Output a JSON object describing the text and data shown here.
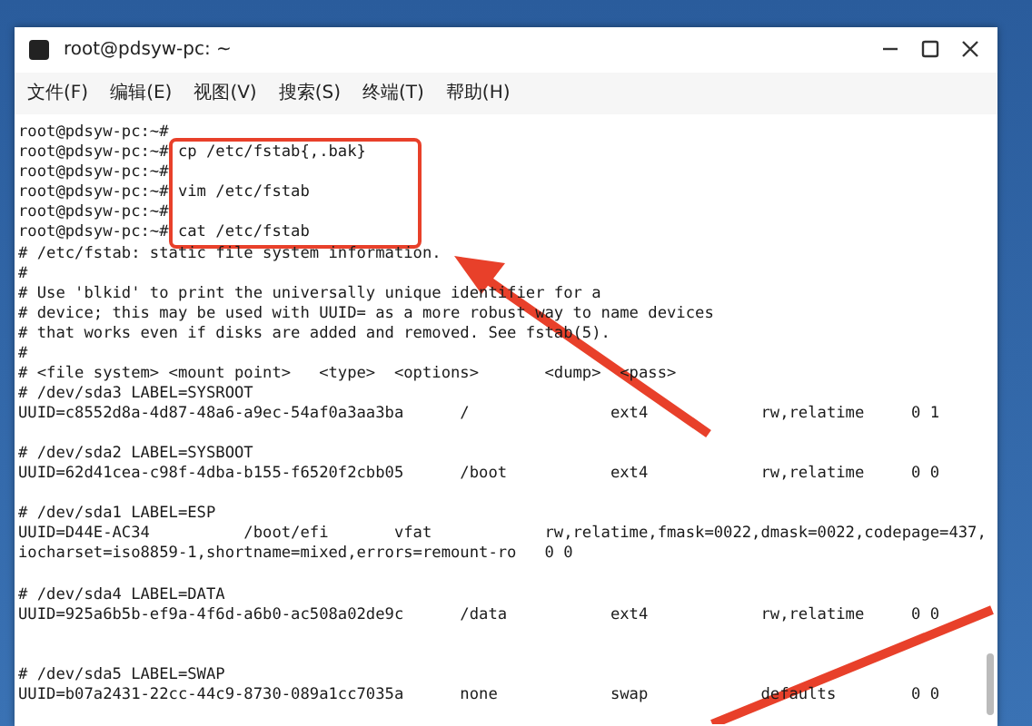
{
  "window": {
    "title": "root@pdsyw-pc: ~"
  },
  "menu": [
    "文件(F)",
    "编辑(E)",
    "视图(V)",
    "搜索(S)",
    "终端(T)",
    "帮助(H)"
  ],
  "terminal": {
    "blocks": [
      {
        "extra_space": false,
        "lines": [
          "root@pdsyw-pc:~#",
          "root@pdsyw-pc:~# cp /etc/fstab{,.bak}",
          "root@pdsyw-pc:~#",
          "root@pdsyw-pc:~# vim /etc/fstab",
          "root@pdsyw-pc:~#",
          "root@pdsyw-pc:~# cat /etc/fstab",
          "# /etc/fstab: static file system information.",
          "#",
          "# Use 'blkid' to print the universally unique identifier for a",
          "# device; this may be used with UUID= as a more robust way to name devices",
          "# that works even if disks are added and removed. See fstab(5).",
          "#",
          "# <file system> <mount point>   <type>  <options>       <dump>  <pass>",
          "# /dev/sda3 LABEL=SYSROOT",
          "UUID=c8552d8a-4d87-48a6-a9ec-54af0a3aa3ba      /               ext4            rw,relatime     0 1"
        ]
      },
      {
        "extra_space": false,
        "lines": [
          "# /dev/sda2 LABEL=SYSBOOT",
          "UUID=62d41cea-c98f-4dba-b155-f6520f2cbb05      /boot           ext4            rw,relatime     0 0"
        ]
      },
      {
        "extra_space": false,
        "lines": [
          "# /dev/sda1 LABEL=ESP",
          "UUID=D44E-AC34          /boot/efi       vfat            rw,relatime,fmask=0022,dmask=0022,codepage=437,",
          "iocharset=iso8859-1,shortname=mixed,errors=remount-ro   0 0"
        ]
      },
      {
        "extra_space": true,
        "lines": [
          "# /dev/sda4 LABEL=DATA",
          "UUID=925a6b5b-ef9a-4f6d-a6b0-ac508a02de9c      /data           ext4            rw,relatime     0 0"
        ]
      },
      {
        "extra_space": false,
        "lines": [
          "# /dev/sda5 LABEL=SWAP",
          "UUID=b07a2431-22cc-44c9-8730-089a1cc7035a      none            swap            defaults        0 0"
        ]
      }
    ]
  }
}
